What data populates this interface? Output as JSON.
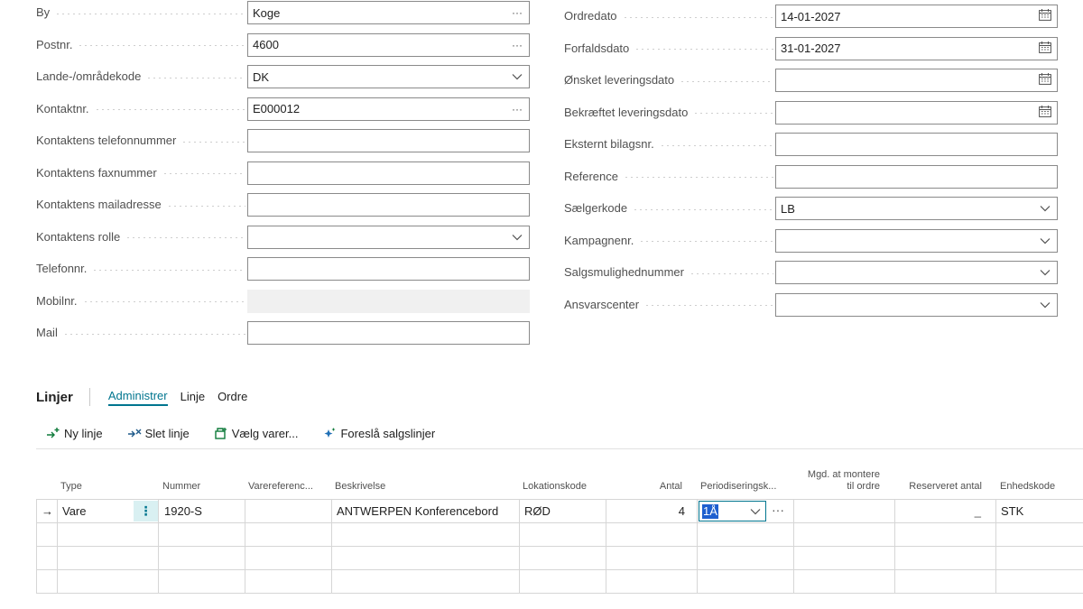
{
  "left_fields": [
    {
      "label": "By",
      "value": "Koge",
      "control": "more",
      "disabled": false
    },
    {
      "label": "Postnr.",
      "value": "4600",
      "control": "more",
      "disabled": false
    },
    {
      "label": "Lande-/områdekode",
      "value": "DK",
      "control": "dropdown",
      "disabled": false
    },
    {
      "label": "Kontaktnr.",
      "value": "E000012",
      "control": "more",
      "disabled": false
    },
    {
      "label": "Kontaktens telefonnummer",
      "value": "",
      "control": "none",
      "disabled": false
    },
    {
      "label": "Kontaktens faxnummer",
      "value": "",
      "control": "none",
      "disabled": false
    },
    {
      "label": "Kontaktens mailadresse",
      "value": "",
      "control": "none",
      "disabled": false
    },
    {
      "label": "Kontaktens rolle",
      "value": "",
      "control": "dropdown",
      "disabled": false
    },
    {
      "label": "Telefonnr.",
      "value": "",
      "control": "none",
      "disabled": false
    },
    {
      "label": "Mobilnr.",
      "value": "",
      "control": "none",
      "disabled": true
    },
    {
      "label": "Mail",
      "value": "",
      "control": "none",
      "disabled": false
    }
  ],
  "right_fields": [
    {
      "label": "Ordredato",
      "value": "14-01-2027",
      "control": "calendar"
    },
    {
      "label": "Forfaldsdato",
      "value": "31-01-2027",
      "control": "calendar"
    },
    {
      "label": "Ønsket leveringsdato",
      "value": "",
      "control": "calendar"
    },
    {
      "label": "Bekræftet leveringsdato",
      "value": "",
      "control": "calendar"
    },
    {
      "label": "Eksternt bilagsnr.",
      "value": "",
      "control": "none"
    },
    {
      "label": "Reference",
      "value": "",
      "control": "none"
    },
    {
      "label": "Sælgerkode",
      "value": "LB",
      "control": "dropdown"
    },
    {
      "label": "Kampagnenr.",
      "value": "",
      "control": "dropdown"
    },
    {
      "label": "Salgsmulighednummer",
      "value": "",
      "control": "dropdown"
    },
    {
      "label": "Ansvarscenter",
      "value": "",
      "control": "dropdown"
    }
  ],
  "lines": {
    "title": "Linjer",
    "tabs": [
      "Administrer",
      "Linje",
      "Ordre"
    ],
    "active_tab": "Administrer",
    "toolbar": [
      "Ny linje",
      "Slet linje",
      "Vælg varer...",
      "Foreslå salgslinjer"
    ],
    "columns": {
      "type": "Type",
      "nummer": "Nummer",
      "varereference": "Varereferenc...",
      "beskrivelse": "Beskrivelse",
      "lokationskode": "Lokationskode",
      "antal": "Antal",
      "periodisering": "Periodiseringsk...",
      "mgd_line1": "Mgd. at montere",
      "mgd_line2": "til ordre",
      "reserveret": "Reserveret antal",
      "enhedskode": "Enhedskode"
    },
    "row": {
      "arrow": "→",
      "type": "Vare",
      "menu": "⋮",
      "nummer": "1920-S",
      "beskrivelse": "ANTWERPEN Konferencebord",
      "lokationskode": "RØD",
      "antal": "4",
      "periodisering": "1Å",
      "more": "···",
      "reserveret": "_",
      "enhedskode": "STK"
    }
  },
  "colors": {
    "accent": "#00758f",
    "border": "#8a8a8a",
    "selection": "#1e5fcf"
  }
}
